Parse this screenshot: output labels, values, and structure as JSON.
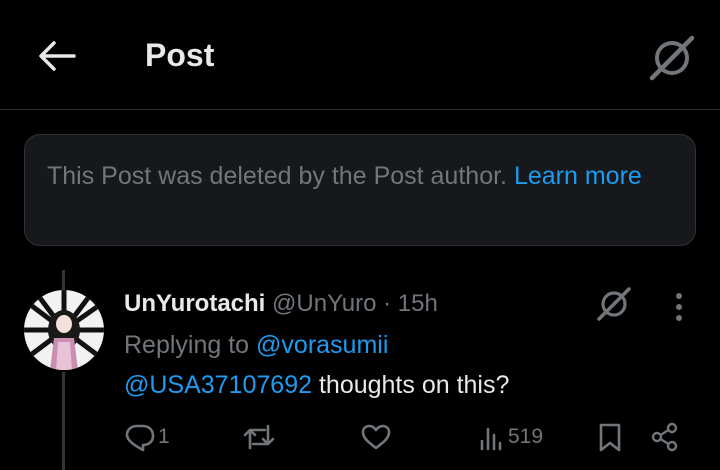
{
  "header": {
    "title": "Post",
    "back_icon": "arrow-left-icon",
    "grok_icon": "grok-icon"
  },
  "deleted_notice": {
    "text": "This Post was deleted by the Post author.",
    "link_text": "Learn more"
  },
  "tweet": {
    "display_name": "UnYurotachi",
    "handle": "@UnYuro",
    "separator": "·",
    "time": "15h",
    "replying_prefix": "Replying to",
    "replying_to": "@vorasumii",
    "mention": "@USA37107692",
    "text": "thoughts on this?",
    "reply_count": "1",
    "views": "519"
  },
  "colors": {
    "background": "#000000",
    "card": "#16181c",
    "border": "#2f3336",
    "link": "#1d9bf0",
    "muted": "#71767b",
    "text": "#e7e9ea"
  }
}
